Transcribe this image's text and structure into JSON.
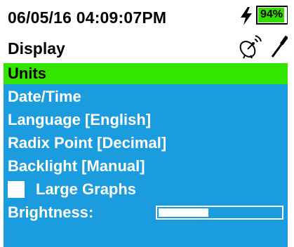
{
  "status": {
    "datetime": "06/05/16  04:09:07PM",
    "battery_percent": "94%",
    "battery_level": 0.94,
    "icons": [
      "bolt-icon",
      "battery-icon"
    ]
  },
  "header": {
    "title": "Display",
    "icons": [
      "satellite-dish-icon",
      "probe-icon"
    ]
  },
  "menu": {
    "items": [
      {
        "label": "Units",
        "selected": true
      },
      {
        "label": "Date/Time"
      },
      {
        "label": "Language [English]"
      },
      {
        "label": "Radix Point [Decimal]"
      },
      {
        "label": "Backlight [Manual]"
      },
      {
        "label": "Large Graphs",
        "checkbox": true,
        "checked": false
      },
      {
        "label": "Brightness:",
        "slider": true,
        "slider_value": 0.42
      }
    ]
  },
  "colors": {
    "menu_background": "#1a9cde",
    "selection": "#33e600",
    "battery_fill": "#33dd00",
    "text_on_menu": "#ffffff"
  }
}
